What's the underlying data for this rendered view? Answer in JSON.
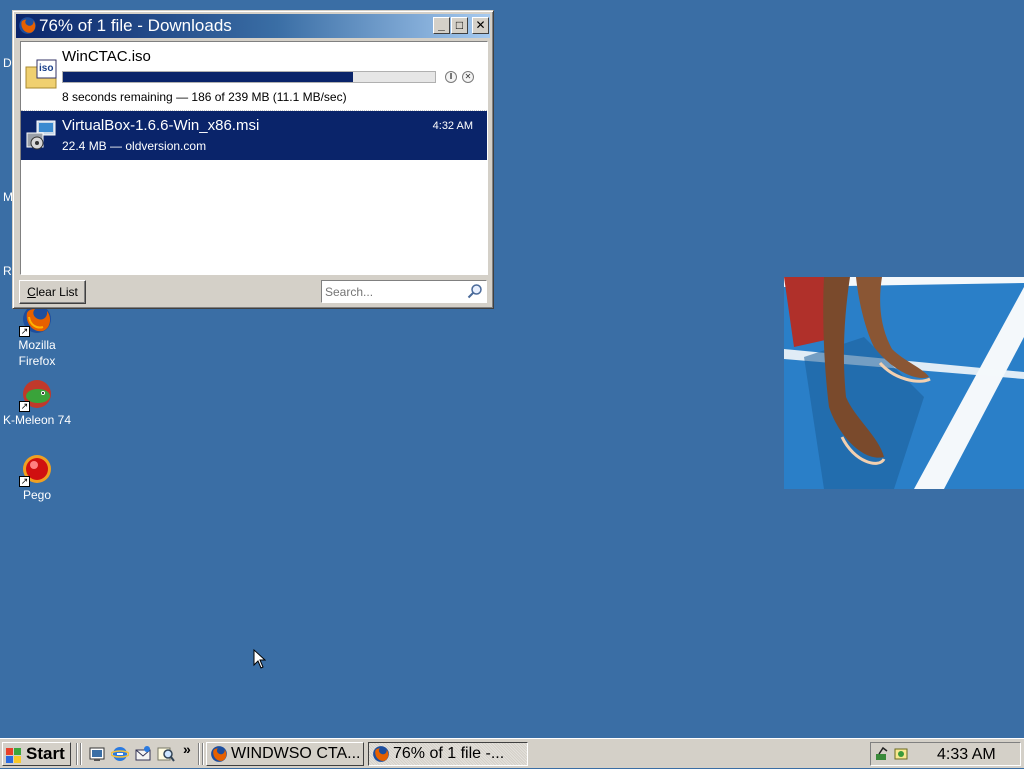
{
  "desktop": {
    "edge_letters": [
      "D",
      "M",
      "R"
    ],
    "icons": [
      {
        "label_line1": "Mozilla",
        "label_line2": "Firefox",
        "icon": "firefox-icon"
      },
      {
        "label_line1": "K-Meleon 74",
        "icon": "kmeleon-icon"
      },
      {
        "label_line1": "Pego",
        "icon": "pego-icon"
      }
    ]
  },
  "downloads_window": {
    "title": "76% of 1 file - Downloads",
    "controls": {
      "minimize": "_",
      "maximize": "□",
      "close": "✕"
    },
    "items": [
      {
        "filename": "WinCTAC.iso",
        "icon_text": "iso",
        "status": "8 seconds remaining — 186 of 239 MB (11.1 MB/sec)",
        "progress": 0.78,
        "pause_glyph": "‖",
        "cancel_glyph": "✕"
      },
      {
        "filename": "VirtualBox-1.6.6-Win_x86.msi",
        "details": "22.4 MB — oldversion.com",
        "time": "4:32 AM",
        "selected": true
      }
    ],
    "clear_button": "Clear List",
    "search_placeholder": "Search..."
  },
  "taskbar": {
    "start_label": "Start",
    "overflow_glyph": "»",
    "tasks": [
      {
        "label": "WINDWSO CTA...",
        "icon": "firefox-icon",
        "active": false
      },
      {
        "label": "76% of 1 file -...",
        "icon": "firefox-icon",
        "active": true
      }
    ],
    "clock": "4:33 AM"
  },
  "colors": {
    "desktop": "#3a6ea5",
    "selection": "#0a246a",
    "window_face": "#d4d0c8"
  }
}
